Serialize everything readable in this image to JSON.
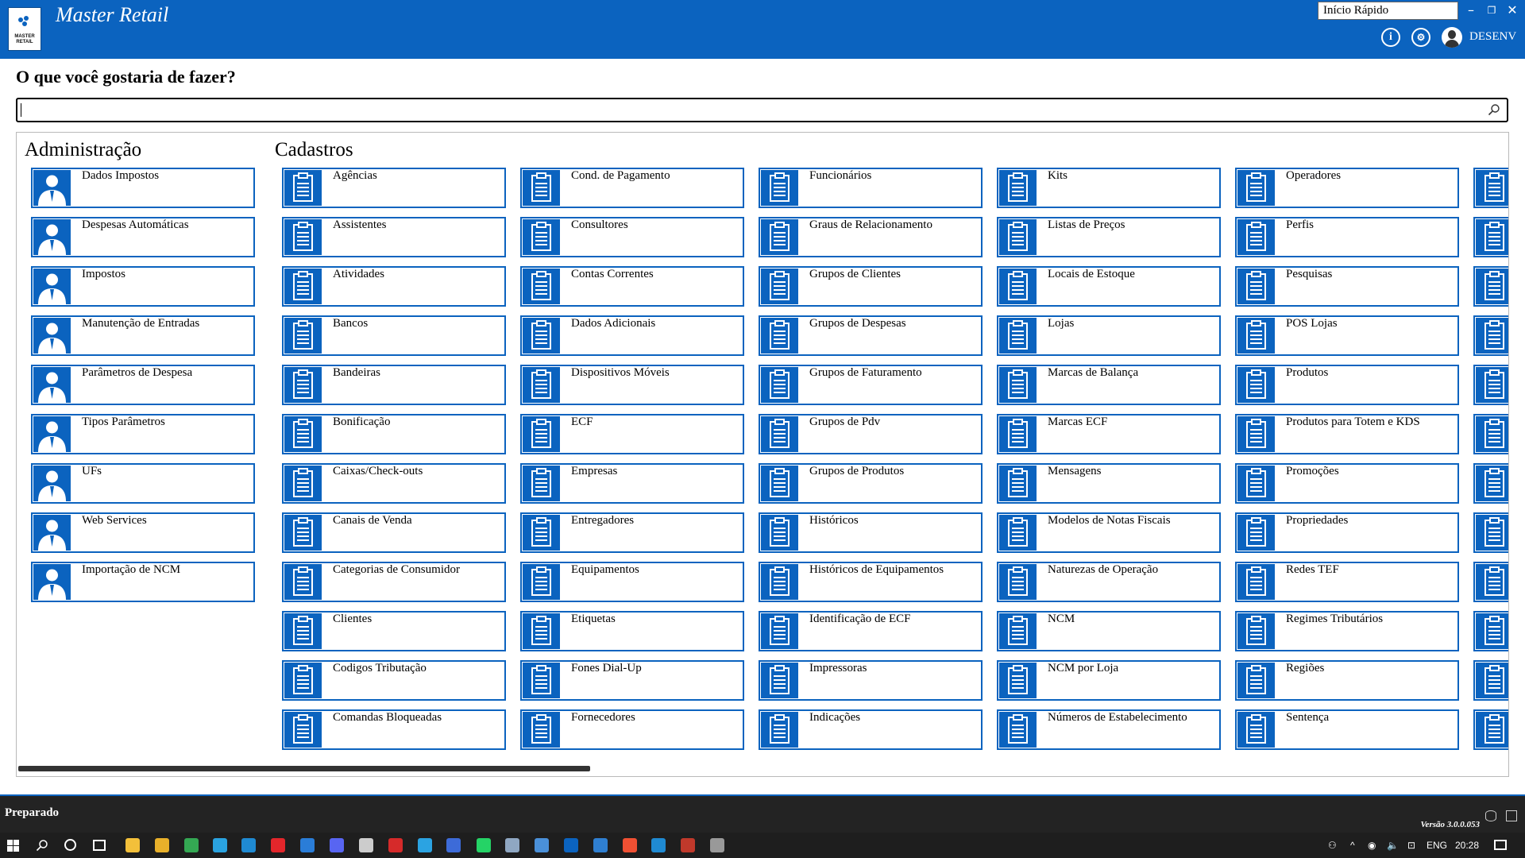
{
  "window": {
    "app_title": "Master Retail",
    "logo_text": "MASTER RETAIL",
    "quick_start": "Início Rápido",
    "username": "DESENV",
    "colors": {
      "accent": "#0b63bf",
      "statusbar": "#232323",
      "taskbar": "#1e1e1e"
    }
  },
  "main": {
    "question": "O que você gostaria de fazer?",
    "search_value": ""
  },
  "groups": {
    "admin": {
      "title": "Administração",
      "icon": "user-icon",
      "items": [
        "Dados Impostos",
        "Despesas Automáticas",
        "Impostos",
        "Manutenção de Entradas",
        "Parâmetros de Despesa",
        "Tipos Parâmetros",
        "UFs",
        "Web Services",
        "Importação de NCM"
      ]
    },
    "cadastros": {
      "title": "Cadastros",
      "icon": "clipboard-icon",
      "columns": [
        [
          "Agências",
          "Assistentes",
          "Atividades",
          "Bancos",
          "Bandeiras",
          "Bonificação",
          "Caixas/Check-outs",
          "Canais de Venda",
          "Categorias de Consumidor",
          "Clientes",
          "Codigos Tributação",
          "Comandas Bloqueadas"
        ],
        [
          "Cond. de Pagamento",
          "Consultores",
          "Contas Correntes",
          "Dados Adicionais",
          "Dispositivos Móveis",
          "ECF",
          "Empresas",
          "Entregadores",
          "Equipamentos",
          "Etiquetas",
          "Fones Dial-Up",
          "Fornecedores"
        ],
        [
          "Funcionários",
          "Graus de Relacionamento",
          "Grupos de Clientes",
          "Grupos de Despesas",
          "Grupos de Faturamento",
          "Grupos de Pdv",
          "Grupos de Produtos",
          "Históricos",
          "Históricos de Equipamentos",
          "Identificação de ECF",
          "Impressoras",
          "Indicações"
        ],
        [
          "Kits",
          "Listas de Preços",
          "Locais de Estoque",
          "Lojas",
          "Marcas de Balança",
          "Marcas ECF",
          "Mensagens",
          "Modelos de Notas Fiscais",
          "Naturezas de Operação",
          "NCM",
          "NCM por Loja",
          "Números de Estabelecimento"
        ],
        [
          "Operadores",
          "Perfis",
          "Pesquisas",
          "POS Lojas",
          "Produtos",
          "Produtos para Totem e KDS",
          "Promoções",
          "Propriedades",
          "Redes TEF",
          "Regimes Tributários",
          "Regiões",
          "Sentença"
        ],
        [
          "",
          "",
          "",
          "",
          "",
          "",
          "",
          "",
          "",
          "",
          "",
          ""
        ]
      ]
    }
  },
  "statusbar": {
    "status": "Preparado",
    "version": "Versão 3.0.0.053"
  },
  "taskbar": {
    "language": "ENG",
    "time": "20:28"
  }
}
